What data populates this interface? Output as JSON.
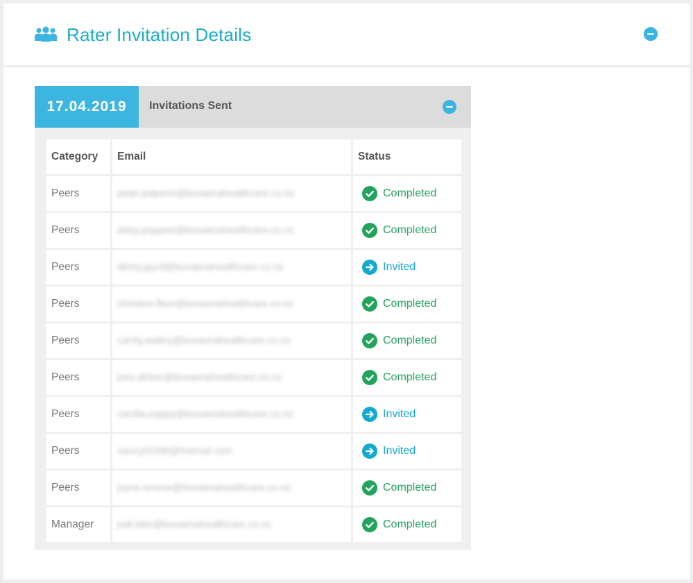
{
  "header": {
    "title": "Rater Invitation Details",
    "icon": "users-group-icon"
  },
  "colors": {
    "accent": "#3cb5e0",
    "title": "#1aaec9",
    "completed": "#22a45d",
    "invited": "#12aad0"
  },
  "panel": {
    "date": "17.04.2019",
    "title": "Invitations Sent"
  },
  "table": {
    "columns": [
      "Category",
      "Email",
      "Status"
    ],
    "rows": [
      {
        "category": "Peers",
        "email": "peter.palpenn@boxaenahealthcare.co.nz",
        "status": "Completed",
        "status_type": "completed"
      },
      {
        "category": "Peers",
        "email": "daisy.paypeel@boxaenahealthcare.co.nz",
        "status": "Completed",
        "status_type": "completed"
      },
      {
        "category": "Peers",
        "email": "dilshy.jpyrd@boxaenahealthcare.co.nz",
        "status": "Invited",
        "status_type": "invited"
      },
      {
        "category": "Peers",
        "email": "christine.fleur@boxaenahealthcare.co.nz",
        "status": "Completed",
        "status_type": "completed"
      },
      {
        "category": "Peers",
        "email": "carrily.walley@boxaenahealthcare.co.nz",
        "status": "Completed",
        "status_type": "completed"
      },
      {
        "category": "Peers",
        "email": "joes.dirlion@boxaenahealthcare.co.nz",
        "status": "Completed",
        "status_type": "completed"
      },
      {
        "category": "Peers",
        "email": "carrilla.eappy@boxaenahealthcare.co.nz",
        "status": "Invited",
        "status_type": "invited"
      },
      {
        "category": "Peers",
        "email": "nancy01996@hotmail.com",
        "status": "Invited",
        "status_type": "invited"
      },
      {
        "category": "Peers",
        "email": "joyce.renese@boxaenahealthcare.co.nz",
        "status": "Completed",
        "status_type": "completed"
      },
      {
        "category": "Manager",
        "email": "jodi.lake@boxaenahealthcare.co.nz",
        "status": "Completed",
        "status_type": "completed"
      }
    ]
  }
}
